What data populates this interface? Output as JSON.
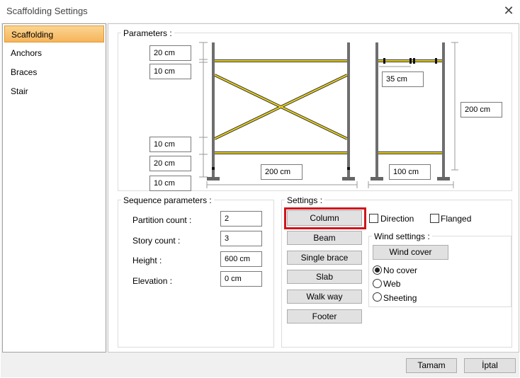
{
  "window": {
    "title": "Scaffolding Settings",
    "close_glyph": "✕"
  },
  "sidebar": {
    "items": [
      {
        "label": "Scaffolding",
        "active": true
      },
      {
        "label": "Anchors",
        "active": false
      },
      {
        "label": "Braces",
        "active": false
      },
      {
        "label": "Stair",
        "active": false
      }
    ]
  },
  "parameters": {
    "label": "Parameters :",
    "left_fields": [
      "20 cm",
      "10 cm",
      "10 cm",
      "20 cm",
      "10 cm"
    ],
    "frame_width": "200 cm",
    "side_top": "35 cm",
    "side_width": "100 cm",
    "side_height": "200 cm"
  },
  "sequence": {
    "label": "Sequence parameters :",
    "rows": [
      {
        "label": "Partition count :",
        "value": "2"
      },
      {
        "label": "Story count :",
        "value": "3"
      },
      {
        "label": "Height :",
        "value": "600 cm"
      },
      {
        "label": "Elevation :",
        "value": "0 cm"
      }
    ]
  },
  "settings": {
    "label": "Settings :",
    "buttons": [
      "Column",
      "Beam",
      "Single brace",
      "Slab",
      "Walk way",
      "Footer"
    ],
    "direction_label": "Direction",
    "flanged_label": "Flanged",
    "wind": {
      "label": "Wind settings :",
      "cover_button": "Wind cover",
      "options": [
        "No cover",
        "Web",
        "Sheeting"
      ],
      "selected": "No cover"
    }
  },
  "footer": {
    "ok_label": "Tamam",
    "cancel_label": "İptal"
  },
  "colors": {
    "highlight": "#d0141b",
    "beam_yellow": "#e8d21a",
    "active_tab": "#f6b45a"
  }
}
